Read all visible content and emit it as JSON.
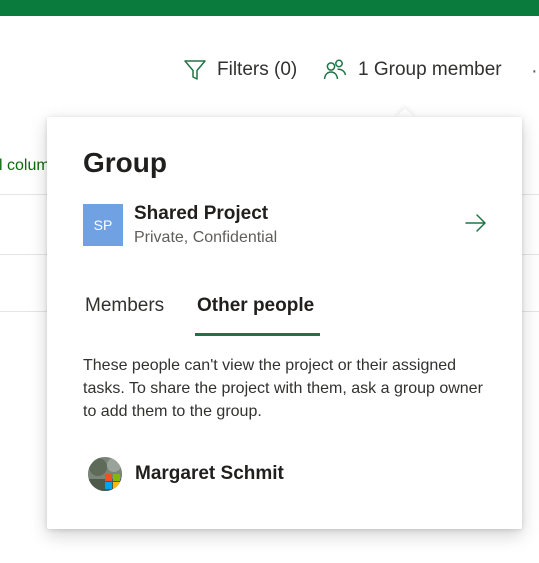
{
  "toolbar": {
    "filters_label": "Filters (0)",
    "members_label": "1 Group member",
    "more_label": "··"
  },
  "background": {
    "partial_link": "l colum"
  },
  "popup": {
    "title": "Group",
    "group": {
      "initials": "SP",
      "name": "Shared Project",
      "description": "Private, Confidential",
      "avatar_color": "#6fa1e3"
    },
    "tabs": [
      {
        "label": "Members",
        "selected": false
      },
      {
        "label": "Other people",
        "selected": true
      }
    ],
    "note": "These people can't view the project or their assigned tasks. To share the project with them, ask a group owner to add them to the group.",
    "people": [
      {
        "name": "Margaret Schmit"
      }
    ]
  },
  "colors": {
    "accent": "#217346",
    "topbar": "#0a7b3c"
  }
}
